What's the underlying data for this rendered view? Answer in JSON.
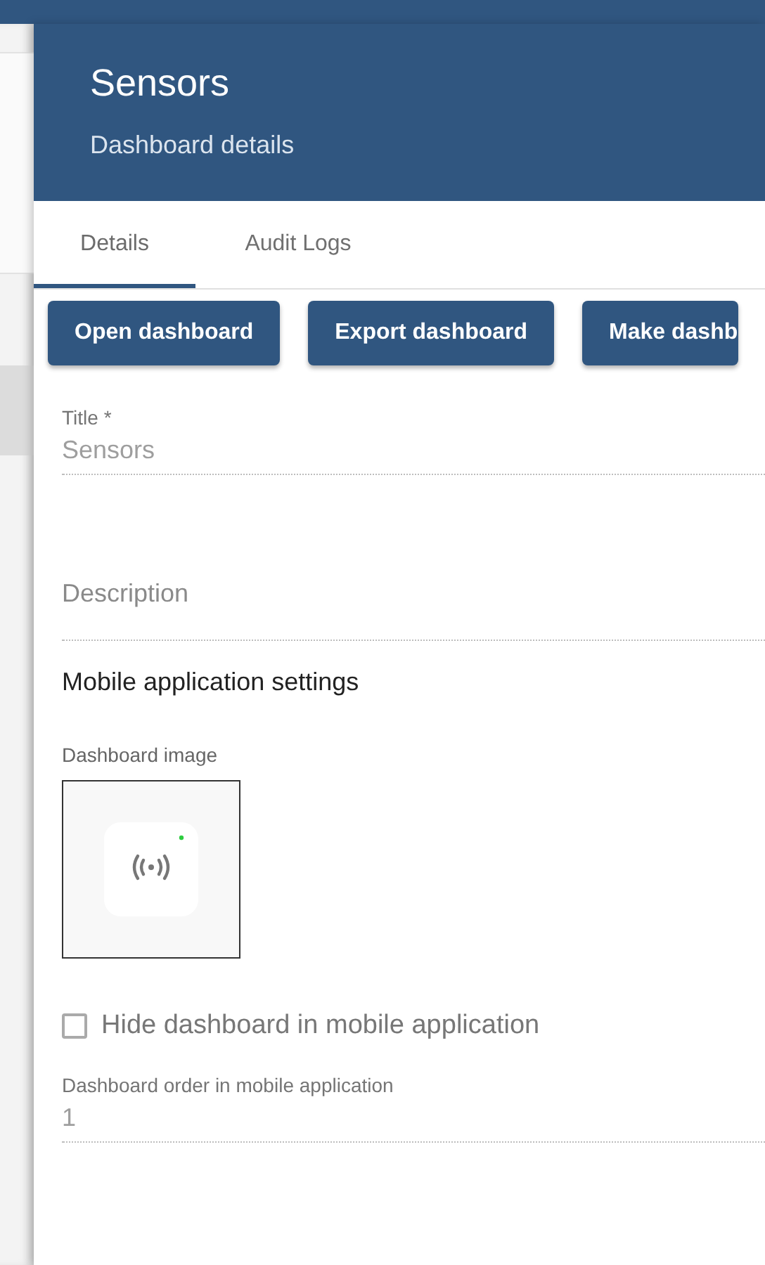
{
  "header": {
    "title": "Sensors",
    "subtitle": "Dashboard details"
  },
  "tabs": [
    {
      "label": "Details",
      "selected": true
    },
    {
      "label": "Audit Logs",
      "selected": false
    }
  ],
  "actions": [
    {
      "label": "Open dashboard"
    },
    {
      "label": "Export dashboard"
    },
    {
      "label": "Make dashb"
    }
  ],
  "fields": [
    {
      "label": "Title *",
      "value": "Sensors",
      "disabled": true
    },
    {
      "placeholder": "Description",
      "disabled": true
    }
  ],
  "mobile_settings": {
    "heading": "Mobile application settings",
    "image_label": "Dashboard image",
    "hide_option": {
      "label": "Hide dashboard in mobile application",
      "checked": false,
      "disabled": true
    },
    "order_field": {
      "label": "Dashboard order in mobile application",
      "value": "1",
      "disabled": true
    }
  }
}
